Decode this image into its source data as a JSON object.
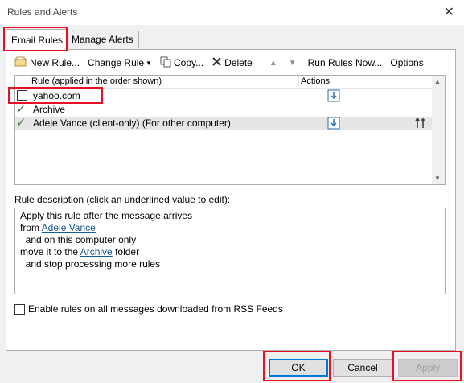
{
  "window": {
    "title": "Rules and Alerts",
    "close_glyph": "✕"
  },
  "tabs": [
    {
      "label": "Email Rules"
    },
    {
      "label": "Manage Alerts"
    }
  ],
  "toolbar": {
    "new_rule": "New Rule...",
    "change_rule": "Change Rule",
    "copy": "Copy...",
    "delete": "Delete",
    "run_rules": "Run Rules Now...",
    "options": "Options"
  },
  "list": {
    "header_rule": "Rule (applied in the order shown)",
    "header_actions": "Actions",
    "rows": [
      {
        "name": "yahoo.com",
        "checked": false
      },
      {
        "name": "Archive",
        "checked": true
      },
      {
        "name": "Adele Vance  (client-only)  (For other computer)",
        "checked": true
      }
    ]
  },
  "description": {
    "label": "Rule description (click an underlined value to edit):",
    "line1": "Apply this rule after the message arrives",
    "line2_prefix": "from ",
    "line2_link": "Adele Vance",
    "line3": "  and on this computer only",
    "line4_prefix": "move it to the ",
    "line4_link": "Archive",
    "line4_suffix": " folder",
    "line5": "  and stop processing more rules"
  },
  "rss_label": "Enable rules on all messages downloaded from RSS Feeds",
  "buttons": {
    "ok": "OK",
    "cancel": "Cancel",
    "apply": "Apply"
  },
  "colors": {
    "highlight": "#e81123",
    "link": "#1a5a96",
    "selected_row": "#e5e5e5"
  }
}
